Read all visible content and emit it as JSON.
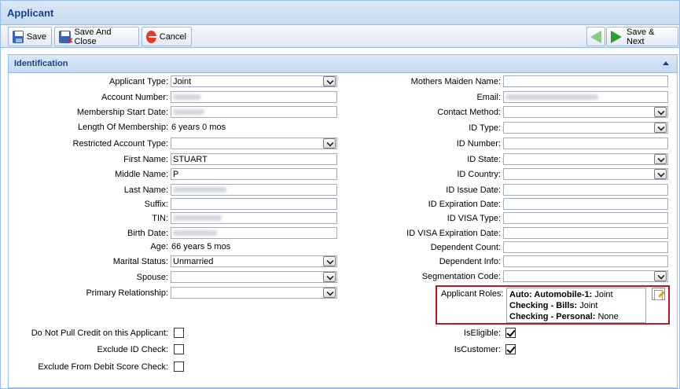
{
  "window": {
    "title": "Applicant"
  },
  "toolbar": {
    "save_label": "Save",
    "save_close_label": "Save And Close",
    "cancel_label": "Cancel",
    "save_next_label": "Save & Next"
  },
  "section": {
    "title": "Identification"
  },
  "left": {
    "applicant_type": {
      "label": "Applicant Type:",
      "value": "Joint"
    },
    "account_number": {
      "label": "Account Number:"
    },
    "membership_start": {
      "label": "Membership Start Date:"
    },
    "length_membership": {
      "label": "Length Of Membership:",
      "value": "6 years 0 mos"
    },
    "restricted_type": {
      "label": "Restricted Account Type:",
      "value": ""
    },
    "first_name": {
      "label": "First Name:",
      "value": "STUART"
    },
    "middle_name": {
      "label": "Middle Name:",
      "value": "P"
    },
    "last_name": {
      "label": "Last Name:"
    },
    "suffix": {
      "label": "Suffix:",
      "value": ""
    },
    "tin": {
      "label": "TIN:"
    },
    "birth_date": {
      "label": "Birth Date:"
    },
    "age": {
      "label": "Age:",
      "value": "66 years 5 mos"
    },
    "marital_status": {
      "label": "Marital Status:",
      "value": "Unmarried"
    },
    "spouse": {
      "label": "Spouse:",
      "value": ""
    },
    "primary_relationship": {
      "label": "Primary Relationship:",
      "value": ""
    }
  },
  "right": {
    "mothers_maiden": {
      "label": "Mothers Maiden Name:",
      "value": ""
    },
    "email": {
      "label": "Email:"
    },
    "contact_method": {
      "label": "Contact Method:",
      "value": ""
    },
    "id_type": {
      "label": "ID Type:",
      "value": ""
    },
    "id_number": {
      "label": "ID Number:",
      "value": ""
    },
    "id_state": {
      "label": "ID State:",
      "value": ""
    },
    "id_country": {
      "label": "ID Country:",
      "value": ""
    },
    "id_issue_date": {
      "label": "ID Issue Date:",
      "value": ""
    },
    "id_expiration": {
      "label": "ID Expiration Date:",
      "value": ""
    },
    "id_visa_type": {
      "label": "ID VISA Type:",
      "value": ""
    },
    "id_visa_expiration": {
      "label": "ID VISA Expiration Date:",
      "value": ""
    },
    "dependent_count": {
      "label": "Dependent Count:",
      "value": ""
    },
    "dependent_info": {
      "label": "Dependent Info:",
      "value": ""
    },
    "segmentation_code": {
      "label": "Segmentation Code:",
      "value": ""
    }
  },
  "roles": {
    "label": "Applicant Roles:",
    "items": [
      {
        "name": "Auto: Automobile-1:",
        "role": "Joint"
      },
      {
        "name": "Checking - Bills:",
        "role": "Joint"
      },
      {
        "name": "Checking - Personal:",
        "role": "None"
      }
    ]
  },
  "checks": {
    "no_pull_credit": {
      "label": "Do Not Pull Credit on this Applicant:",
      "checked": false
    },
    "exclude_id": {
      "label": "Exclude ID Check:",
      "checked": false
    },
    "exclude_debit": {
      "label": "Exclude From Debit Score Check:",
      "checked": false
    },
    "is_eligible": {
      "label": "IsEligible:",
      "checked": true
    },
    "is_customer": {
      "label": "IsCustomer:",
      "checked": true
    }
  }
}
